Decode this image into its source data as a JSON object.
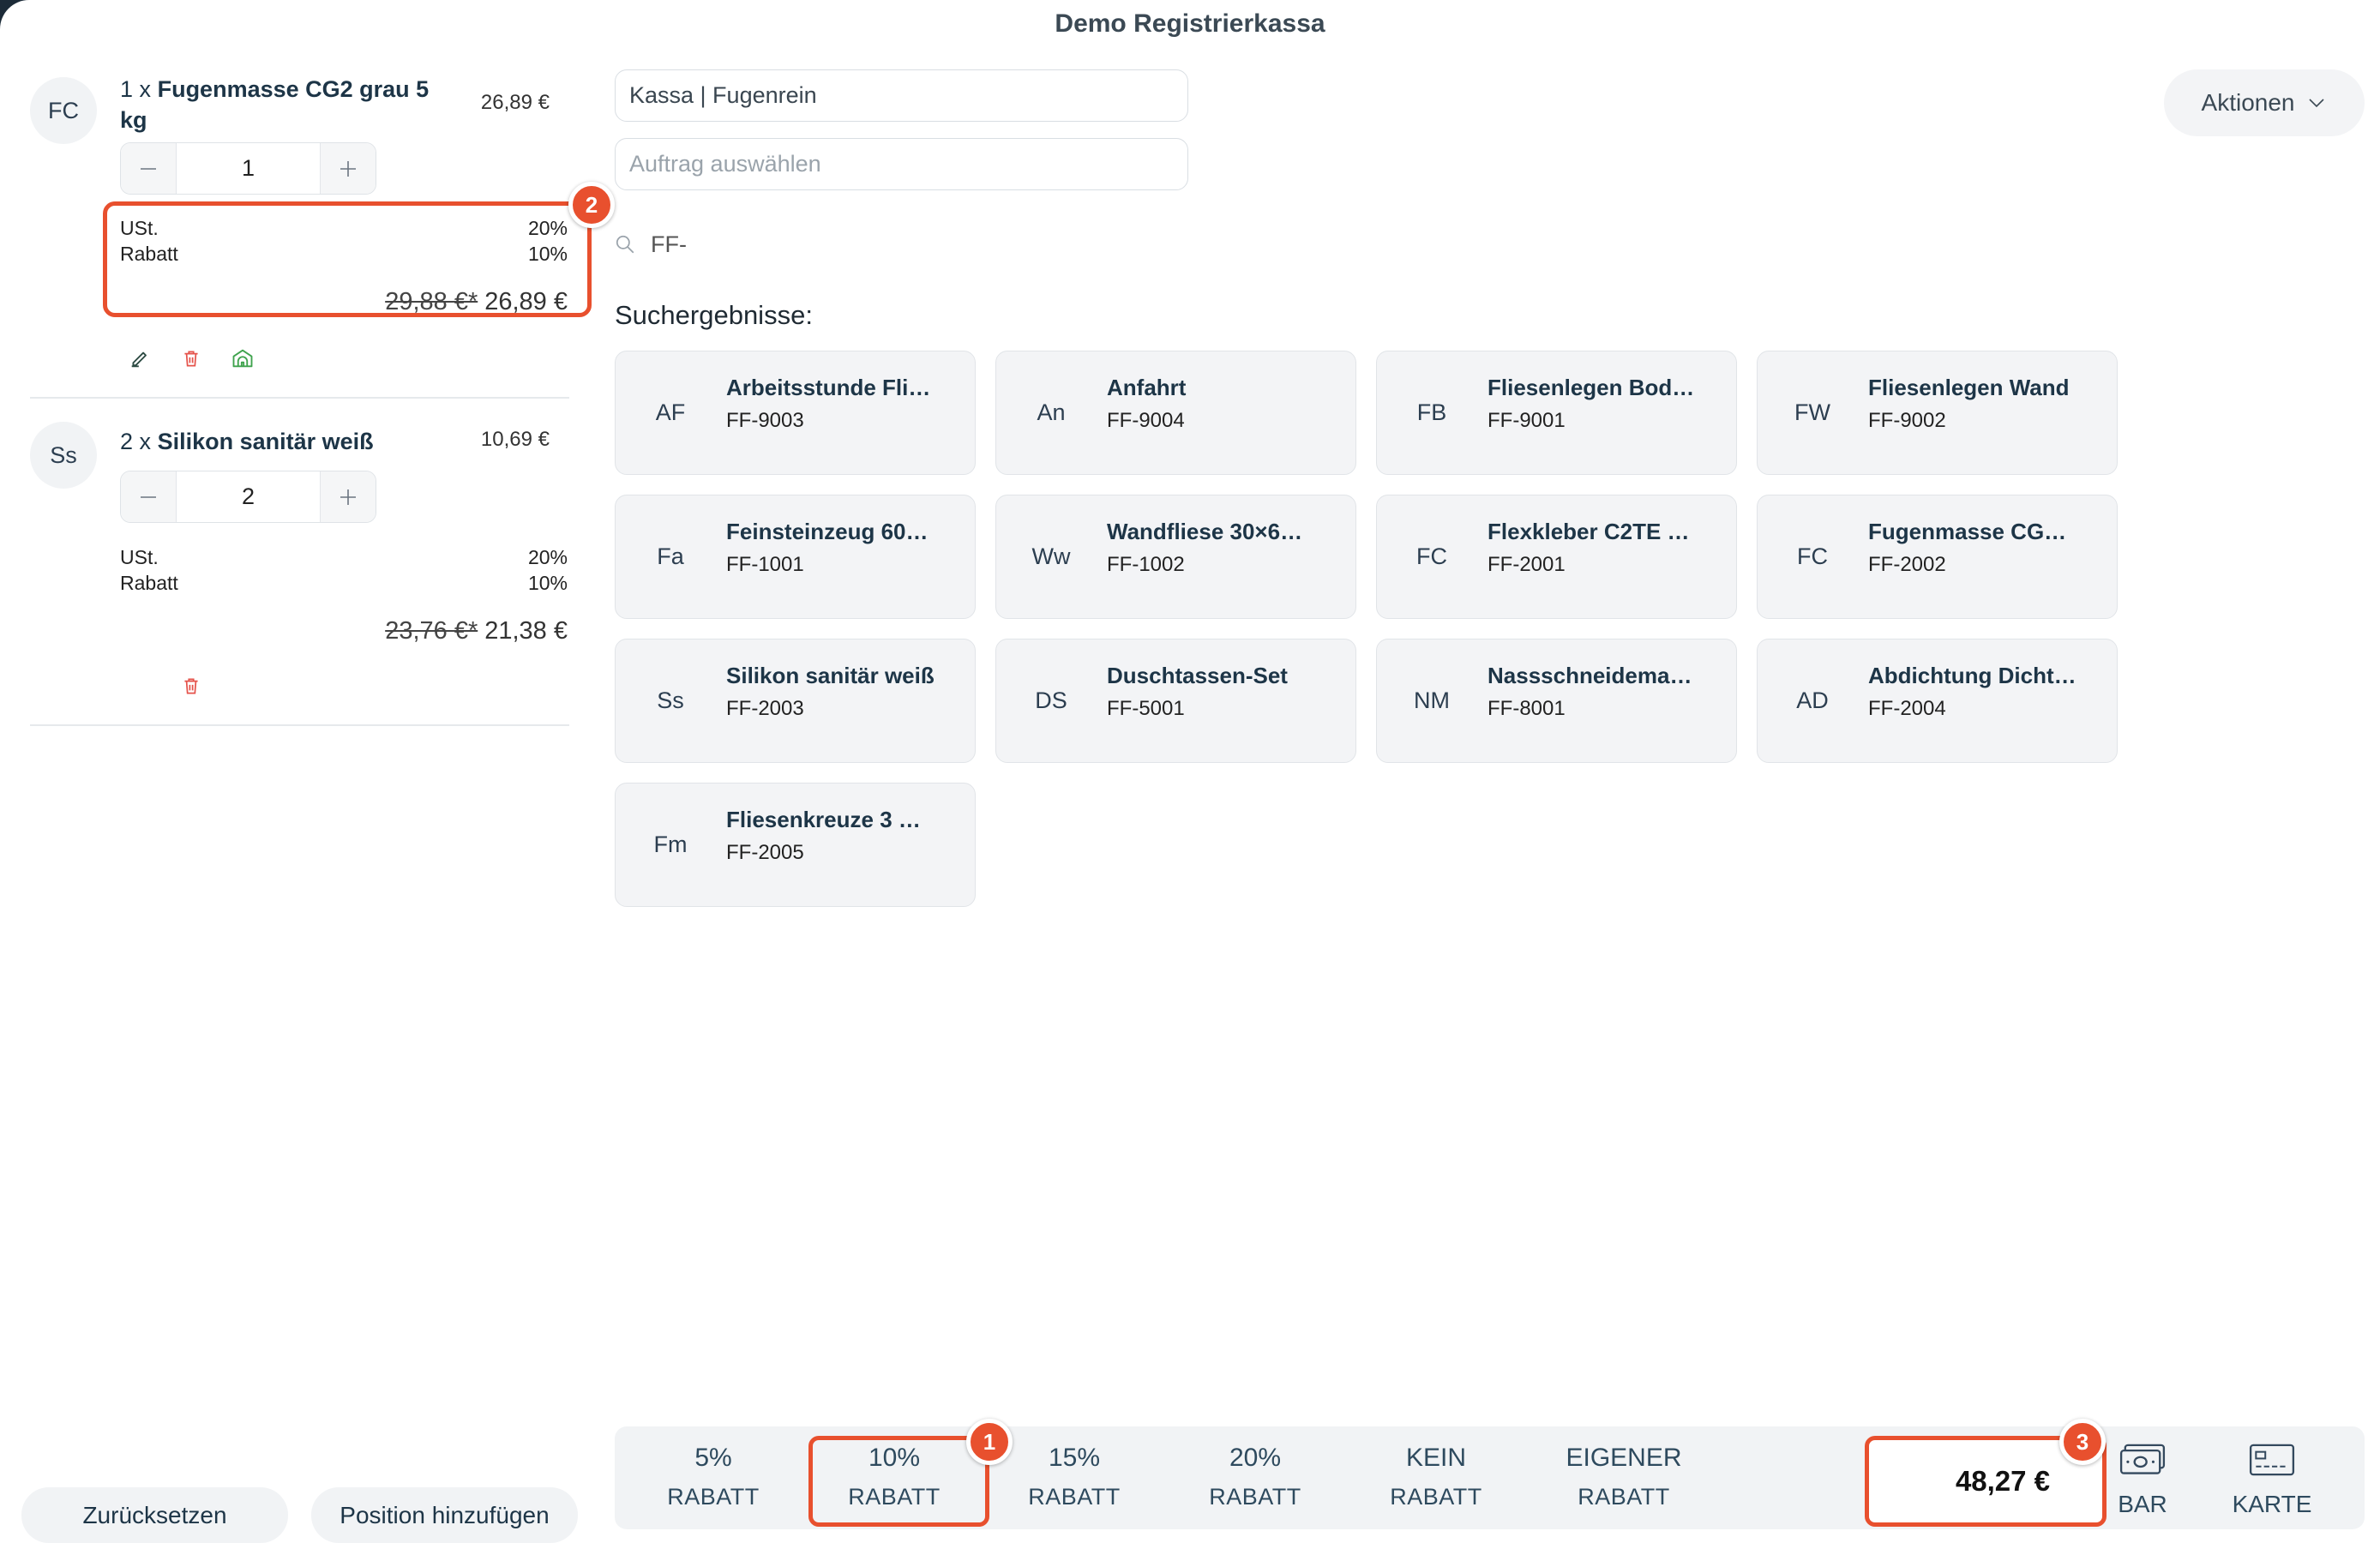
{
  "app": {
    "title": "Demo Registrierkassa"
  },
  "colors": {
    "accent": "#e8502e",
    "text": "#1d3547",
    "card_bg": "#f3f4f6",
    "edit_icon": "#2d4b43",
    "delete_icon": "#e5534b",
    "stock_icon": "#3fa34d"
  },
  "icons": {
    "search": "search-icon",
    "dropdown": "chevron-down-icon",
    "cash": "banknote-icon",
    "card": "credit-card-icon",
    "decrease": "minus-icon",
    "increase": "plus-icon"
  },
  "cart": {
    "items": [
      {
        "avatar": "FC",
        "qty_prefix": "1 x",
        "name": "Fugenmasse CG2 grau 5 kg",
        "unit_price": "26,89 €",
        "quantity": "1",
        "vat_label": "USt.",
        "vat_value": "20%",
        "discount_label": "Rabatt",
        "discount_value": "10%",
        "original_price": "29,88 €*",
        "final_price": "26,89 €",
        "actions": [
          "pencil-icon",
          "trash-icon",
          "warehouse-icon"
        ]
      },
      {
        "avatar": "Ss",
        "qty_prefix": "2 x",
        "name": "Silikon sanitär weiß",
        "unit_price": "10,69 €",
        "quantity": "2",
        "vat_label": "USt.",
        "vat_value": "20%",
        "discount_label": "Rabatt",
        "discount_value": "10%",
        "original_price": "23,76 €*",
        "final_price": "21,38 €",
        "actions": [
          "trash-icon"
        ]
      }
    ],
    "reset_label": "Zurücksetzen",
    "add_position_label": "Position hinzufügen"
  },
  "register": {
    "value": "Kassa | Fugenrein"
  },
  "order": {
    "placeholder": "Auftrag auswählen"
  },
  "search": {
    "value": "FF-",
    "results_label": "Suchergebnisse:"
  },
  "actions_menu": {
    "label": "Aktionen"
  },
  "products": [
    {
      "abbr": "AF",
      "name": "Arbeitsstunde Fli…",
      "code": "FF-9003"
    },
    {
      "abbr": "An",
      "name": "Anfahrt",
      "code": "FF-9004"
    },
    {
      "abbr": "FB",
      "name": "Fliesenlegen Bod…",
      "code": "FF-9001"
    },
    {
      "abbr": "FW",
      "name": "Fliesenlegen Wand",
      "code": "FF-9002"
    },
    {
      "abbr": "Fa",
      "name": "Feinsteinzeug 60…",
      "code": "FF-1001"
    },
    {
      "abbr": "Ww",
      "name": "Wandfliese 30×6…",
      "code": "FF-1002"
    },
    {
      "abbr": "FC",
      "name": "Flexkleber C2TE …",
      "code": "FF-2001"
    },
    {
      "abbr": "FC",
      "name": "Fugenmasse CG…",
      "code": "FF-2002"
    },
    {
      "abbr": "Ss",
      "name": "Silikon sanitär weiß",
      "code": "FF-2003"
    },
    {
      "abbr": "DS",
      "name": "Duschtassen-Set",
      "code": "FF-5001"
    },
    {
      "abbr": "NM",
      "name": "Nassschneidema…",
      "code": "FF-8001"
    },
    {
      "abbr": "AD",
      "name": "Abdichtung Dicht…",
      "code": "FF-2004"
    },
    {
      "abbr": "Fm",
      "name": "Fliesenkreuze 3 …",
      "code": "FF-2005"
    }
  ],
  "discounts": [
    {
      "value": "5%",
      "label": "RABATT",
      "selected": false
    },
    {
      "value": "10%",
      "label": "RABATT",
      "selected": true
    },
    {
      "value": "15%",
      "label": "RABATT",
      "selected": false
    },
    {
      "value": "20%",
      "label": "RABATT",
      "selected": false
    },
    {
      "value": "KEIN",
      "label": "RABATT",
      "selected": false
    },
    {
      "value": "EIGENER",
      "label": "RABATT",
      "selected": false
    }
  ],
  "total": "48,27 €",
  "payment": {
    "cash_label": "BAR",
    "card_label": "KARTE"
  },
  "annotations": [
    "1",
    "2",
    "3"
  ]
}
